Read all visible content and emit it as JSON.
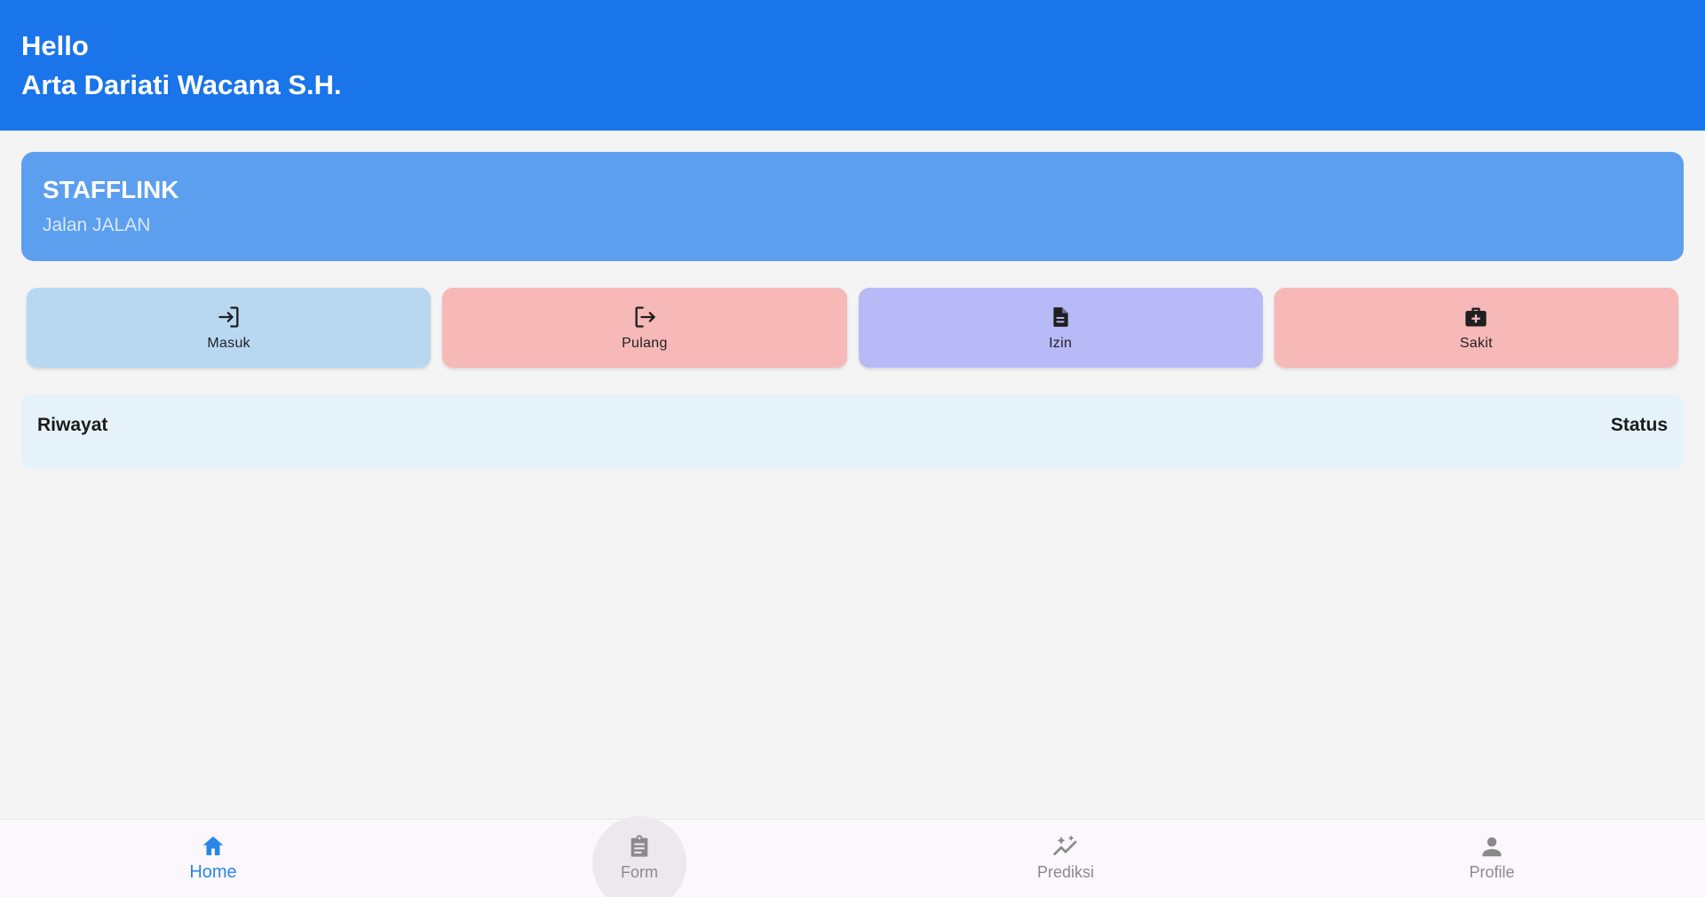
{
  "header": {
    "greeting": "Hello",
    "username": "Arta Dariati Wacana S.H."
  },
  "company": {
    "name": "STAFFLINK",
    "address": "Jalan JALAN"
  },
  "actions": [
    {
      "label": "Masuk",
      "icon": "login-icon",
      "color": "#b8d8f2"
    },
    {
      "label": "Pulang",
      "icon": "logout-icon",
      "color": "#f7b8b8"
    },
    {
      "label": "Izin",
      "icon": "document-icon",
      "color": "#b8b9f7"
    },
    {
      "label": "Sakit",
      "icon": "medical-bag-icon",
      "color": "#f7b8b8"
    }
  ],
  "history": {
    "title": "Riwayat",
    "status_label": "Status"
  },
  "bottom_nav": {
    "items": [
      {
        "label": "Home",
        "icon": "home-icon",
        "active": true
      },
      {
        "label": "Form",
        "icon": "clipboard-icon",
        "active": false
      },
      {
        "label": "Prediksi",
        "icon": "trend-sparkle-icon",
        "active": false
      },
      {
        "label": "Profile",
        "icon": "person-icon",
        "active": false
      }
    ]
  },
  "colors": {
    "primary": "#1a74ea",
    "card": "#5c9fef",
    "active_nav": "#2a86e6",
    "inactive_nav": "#8a8a8a"
  }
}
